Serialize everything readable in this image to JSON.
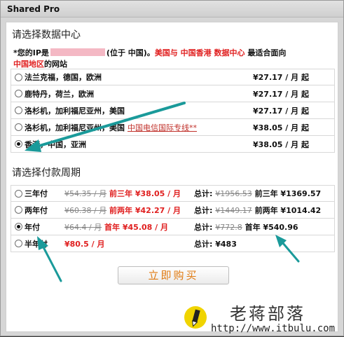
{
  "window": {
    "title": "Shared Pro"
  },
  "datacenter": {
    "heading": "请选择数据中心",
    "notice": {
      "prefix": "*您的IP是",
      "after_ip": "(位于 中国)。",
      "highlight": "美国与 中国香港 数据中心",
      "middle": " 最适合面向",
      "region": "中国地区",
      "suffix": "的网站"
    },
    "options": [
      {
        "label": "法兰克福，德国，欧洲",
        "price": "¥27.17 / 月 起",
        "checked": false
      },
      {
        "label": "鹿特丹，荷兰，欧洲",
        "price": "¥27.17 / 月 起",
        "checked": false
      },
      {
        "label": "洛杉机，加利福尼亚州，美国",
        "price": "¥27.17 / 月 起",
        "checked": false
      },
      {
        "label": "洛杉机，加利福尼亚州，美国",
        "link": "中国电信国际专线**",
        "price": "¥38.05 / 月 起",
        "checked": false
      },
      {
        "label": "香港，中国，亚洲",
        "price": "¥38.05 / 月 起",
        "checked": true
      }
    ]
  },
  "billing": {
    "heading": "请选择付款周期",
    "options": [
      {
        "label": "三年付",
        "old_price": "¥54.35 / 月",
        "offer": "前三年 ¥38.05 / 月",
        "total_label": "总计:",
        "old_total": "¥1956.53",
        "total": "前三年 ¥1369.57",
        "checked": false
      },
      {
        "label": "两年付",
        "old_price": "¥60.38 / 月",
        "offer": "前两年 ¥42.27 / 月",
        "total_label": "总计:",
        "old_total": "¥1449.17",
        "total": "前两年 ¥1014.42",
        "checked": false
      },
      {
        "label": "年付",
        "old_price": "¥64.4 / 月",
        "offer": "首年 ¥45.08 / 月",
        "total_label": "总计:",
        "old_total": "¥772.8",
        "total": "首年 ¥540.96",
        "checked": true
      },
      {
        "label": "半年付",
        "old_price": "",
        "offer": "¥80.5 / 月",
        "total_label": "总计:",
        "old_total": "",
        "total": "¥483",
        "checked": false
      }
    ],
    "buy_button": "立即购买"
  },
  "watermark": {
    "name": "老蒋部落",
    "url": "http://www.itbulu.com"
  },
  "colors": {
    "accent_red": "#e02020",
    "arrow": "#1a9a9a",
    "button_text": "#e07a10"
  }
}
